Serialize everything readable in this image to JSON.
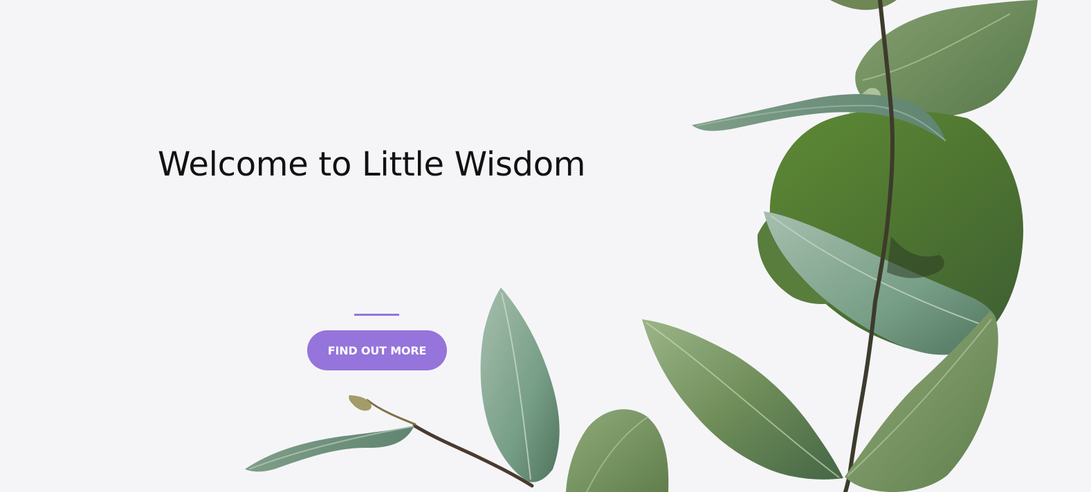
{
  "hero": {
    "title": "Welcome to Little Wisdom",
    "cta_label": "FIND OUT MORE",
    "background_color": "#f5f5f8",
    "accent_color": "#9574db",
    "title_color": "#111111",
    "decoration": "eucalyptus-branch-image"
  }
}
